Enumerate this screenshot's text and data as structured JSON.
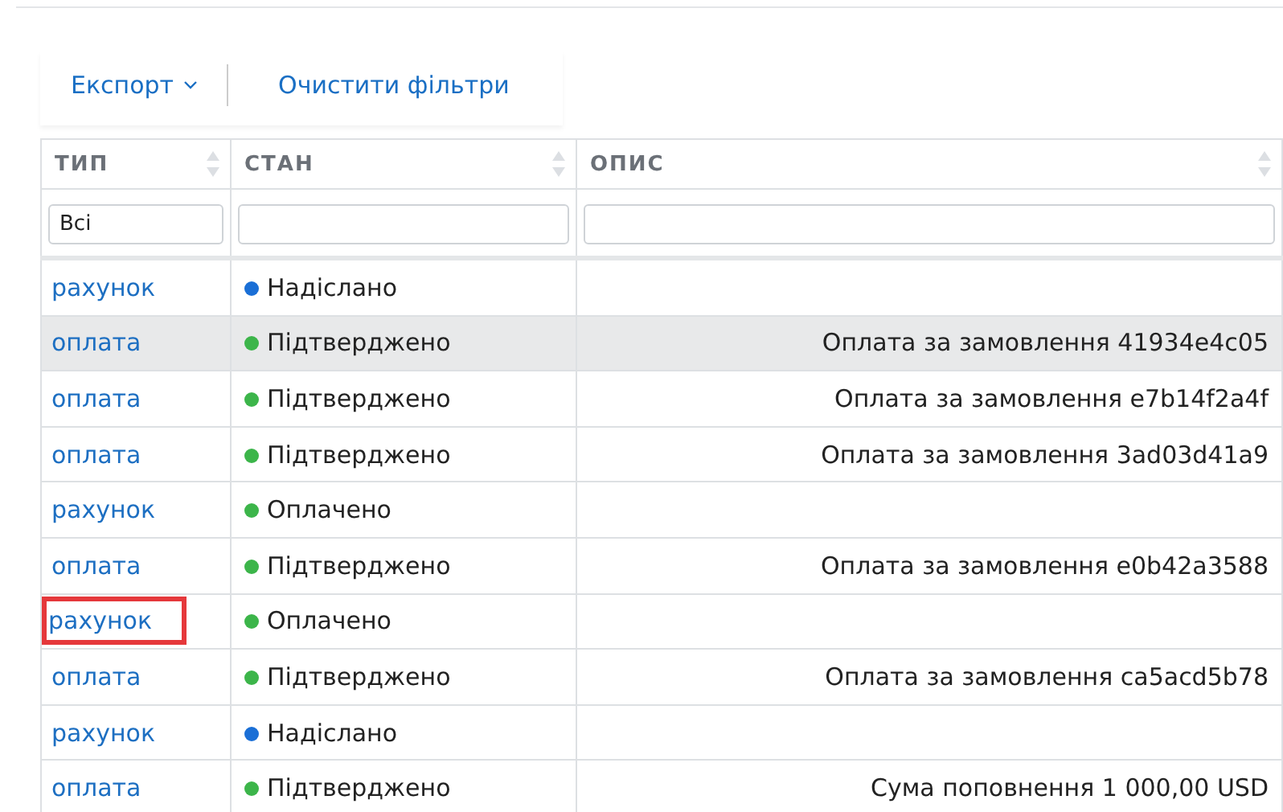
{
  "toolbar": {
    "export_label": "Експорт",
    "clear_label": "Очистити фільтри"
  },
  "table": {
    "columns": [
      {
        "label": "ТИП",
        "sortable": true,
        "filter_value": "Всі"
      },
      {
        "label": "СТАН",
        "sortable": true
      },
      {
        "label": "ОПИС",
        "sortable": true
      }
    ],
    "rows": [
      {
        "type": "рахунок",
        "status": "Надіслано",
        "color": "#1a6fd6",
        "shaded": false,
        "outlined": false
      },
      {
        "type": "оплата",
        "status": "Підтверджено",
        "color": "#3cb54a",
        "description": "Оплата за замовлення 41934e4c05",
        "shaded": true,
        "outlined": false
      },
      {
        "type": "оплата",
        "status": "Підтверджено",
        "color": "#3cb54a",
        "description": "Оплата за замовлення e7b14f2a4f",
        "shaded": false,
        "outlined": false
      },
      {
        "type": "оплата",
        "status": "Підтверджено",
        "color": "#3cb54a",
        "description": "Оплата за замовлення 3ad03d41a9",
        "shaded": false,
        "outlined": false
      },
      {
        "type": "рахунок",
        "status": "Оплачено",
        "color": "#3cb54a",
        "shaded": false,
        "outlined": false
      },
      {
        "type": "оплата",
        "status": "Підтверджено",
        "color": "#3cb54a",
        "description": "Оплата за замовлення e0b42a3588",
        "shaded": false,
        "outlined": false
      },
      {
        "type": "рахунок",
        "status": "Оплачено",
        "color": "#3cb54a",
        "shaded": false,
        "outlined": true
      },
      {
        "type": "оплата",
        "status": "Підтверджено",
        "color": "#3cb54a",
        "description": "Оплата за замовлення ca5acd5b78",
        "shaded": false,
        "outlined": false
      },
      {
        "type": "рахунок",
        "status": "Надіслано",
        "color": "#1a6fd6",
        "shaded": false,
        "outlined": false
      },
      {
        "type": "оплата",
        "status": "Підтверджено",
        "color": "#3cb54a",
        "description": "Сума поповнення 1 000,00 USD",
        "shaded": false,
        "outlined": false
      }
    ]
  }
}
